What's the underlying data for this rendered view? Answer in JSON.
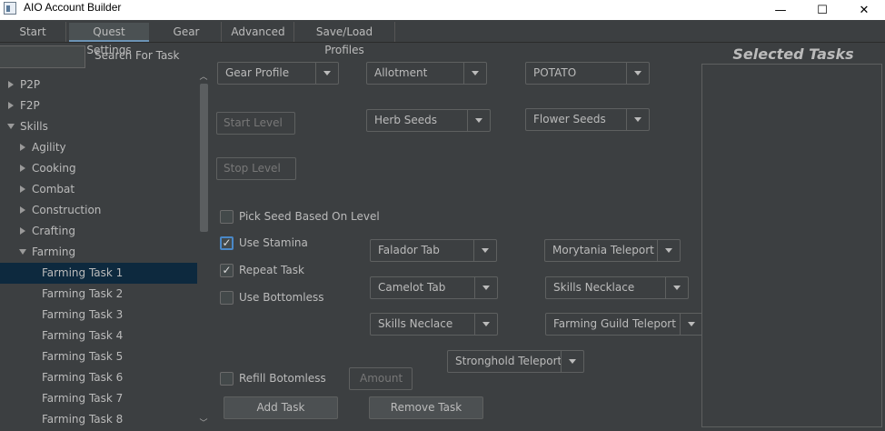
{
  "window": {
    "title": "AIO Account Builder",
    "minimize": "—",
    "maximize": "☐",
    "close": "✕"
  },
  "tabs": [
    "Start",
    "Quest Settings",
    "Gear",
    "Advanced",
    "Save/Load Profiles"
  ],
  "active_tab": "Quest Settings",
  "search": {
    "value": "",
    "label": "Search For Task"
  },
  "tree": [
    {
      "label": "P2P",
      "state": "collapsed"
    },
    {
      "label": "F2P",
      "state": "collapsed"
    },
    {
      "label": "Skills",
      "state": "expanded"
    },
    {
      "label": "Agility",
      "state": "collapsed"
    },
    {
      "label": "Cooking",
      "state": "collapsed"
    },
    {
      "label": "Combat",
      "state": "collapsed"
    },
    {
      "label": "Construction",
      "state": "collapsed"
    },
    {
      "label": "Crafting",
      "state": "collapsed"
    },
    {
      "label": "Farming",
      "state": "expanded"
    },
    {
      "label": "Farming Task 1",
      "state": "leaf",
      "selected": true
    },
    {
      "label": "Farming Task 2",
      "state": "leaf"
    },
    {
      "label": "Farming Task 3",
      "state": "leaf"
    },
    {
      "label": "Farming Task 4",
      "state": "leaf"
    },
    {
      "label": "Farming Task 5",
      "state": "leaf"
    },
    {
      "label": "Farming Task 6",
      "state": "leaf"
    },
    {
      "label": "Farming Task 7",
      "state": "leaf"
    },
    {
      "label": "Farming Task 8",
      "state": "leaf"
    }
  ],
  "settings": {
    "gear_profile": "Gear Profile",
    "allotment": "Allotment",
    "crop": "POTATO",
    "start_level": "Start Level",
    "herb": "Herb Seeds",
    "flower": "Flower Seeds",
    "stop_level": "Stop Level",
    "pick_seed": {
      "label": "Pick Seed Based On Level",
      "checked": false
    },
    "use_stamina": {
      "label": "Use Stamina",
      "checked": true
    },
    "repeat_task": {
      "label": "Repeat Task",
      "checked": true
    },
    "use_bottomless": {
      "label": "Use Bottomless",
      "checked": false
    },
    "refill_bottomless": {
      "label": "Refill Botomless",
      "checked": false
    },
    "amount": "Amount",
    "teleports": {
      "falador": "Falador Tab",
      "morytania": "Morytania Teleport",
      "camelot": "Camelot Tab",
      "skills_necklace": "Skills Necklace",
      "skills_neclace": "Skills Neclace",
      "farming_guild": "Farming Guild Teleport",
      "stronghold": "Stronghold Teleport"
    },
    "add_task": "Add Task",
    "remove_task": "Remove Task"
  },
  "selected_tasks": {
    "title": "Selected Tasks",
    "items": []
  }
}
